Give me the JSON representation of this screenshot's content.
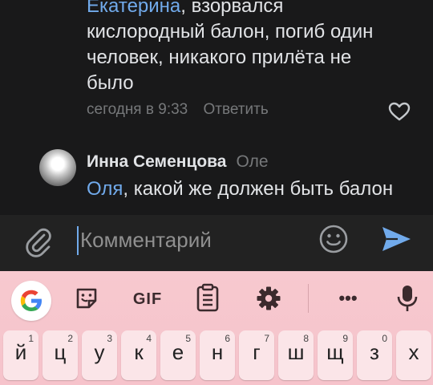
{
  "comment1": {
    "mention": "Екатерина",
    "text_line1": ", взорвался",
    "text_line2": "кислородный балон, погиб один",
    "text_line3": "человек, никакого прилёта не",
    "text_line4": "было",
    "time": "сегодня в 9:33",
    "reply_label": "Ответить"
  },
  "comment2": {
    "author": "Инна Семенцова",
    "reply_to": "Оле",
    "mention": "Оля",
    "text": ", какой же должен быть балон"
  },
  "composer": {
    "placeholder": "Комментарий"
  },
  "keyboard": {
    "gif_label": "GIF",
    "more_label": "•••",
    "keys": [
      {
        "letter": "й",
        "num": "1"
      },
      {
        "letter": "ц",
        "num": "2"
      },
      {
        "letter": "у",
        "num": "3"
      },
      {
        "letter": "к",
        "num": "4"
      },
      {
        "letter": "е",
        "num": "5"
      },
      {
        "letter": "н",
        "num": "6"
      },
      {
        "letter": "г",
        "num": "7"
      },
      {
        "letter": "ш",
        "num": "8"
      },
      {
        "letter": "щ",
        "num": "9"
      },
      {
        "letter": "з",
        "num": "0"
      },
      {
        "letter": "х",
        "num": ""
      }
    ]
  },
  "colors": {
    "background": "#19191a",
    "text": "#e1e3e6",
    "secondary_text": "#76787a",
    "accent": "#71aaeb",
    "keyboard_bg": "#f6c3cb",
    "key_bg": "#fbe5e8"
  },
  "icons": [
    "heart-icon",
    "attach-icon",
    "emoji-icon",
    "send-icon",
    "google-icon",
    "sticker-icon",
    "clipboard-icon",
    "gear-icon",
    "mic-icon"
  ]
}
